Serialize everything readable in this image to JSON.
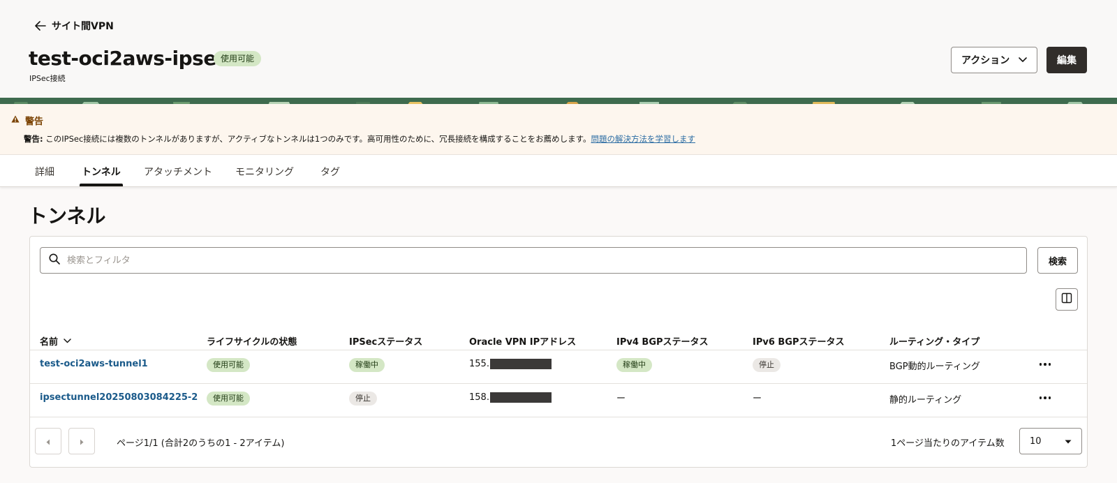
{
  "header": {
    "back_label": "サイト間VPN",
    "title": "test-oci2aws-ipsec",
    "status_badge": "使用可能",
    "subtitle": "IPSec接続",
    "action_label": "アクション",
    "edit_label": "編集"
  },
  "warning": {
    "title": "警告",
    "prefix": "警告:",
    "message": " このIPSec接続には複数のトンネルがありますが、アクティブなトンネルは1つのみです。高可用性のために、冗長接続を構成することをお薦めします。",
    "link": "問題の解決方法を学習します"
  },
  "tabs": [
    {
      "label": "詳細"
    },
    {
      "label": "トンネル"
    },
    {
      "label": "アタッチメント"
    },
    {
      "label": "モニタリング"
    },
    {
      "label": "タグ"
    }
  ],
  "active_tab": "トンネル",
  "section_title": "トンネル",
  "search": {
    "placeholder": "検索とフィルタ",
    "button": "検索"
  },
  "table": {
    "columns": [
      "名前",
      "ライフサイクルの状態",
      "IPSecステータス",
      "Oracle VPN IPアドレス",
      "IPv4 BGPステータス",
      "IPv6 BGPステータス",
      "ルーティング・タイプ"
    ],
    "rows": [
      {
        "name": "test-oci2aws-tunnel1",
        "lifecycle": "使用可能",
        "ipsec_status": "稼働中",
        "ip_prefix": "155.",
        "ipv4_bgp": "稼働中",
        "ipv6_bgp": "停止",
        "routing": "BGP動的ルーティング"
      },
      {
        "name": "ipsectunnel20250803084225-2",
        "lifecycle": "使用可能",
        "ipsec_status": "停止",
        "ip_prefix": "158.",
        "ipv4_bgp": "ー",
        "ipv6_bgp": "ー",
        "routing": "静的ルーティング"
      }
    ]
  },
  "pagination": {
    "summary": "ページ1/1 (合計2のうちの1 - 2アイテム)",
    "per_page_label": "1ページ当たりのアイテム数",
    "per_page_value": "10"
  },
  "colors": {
    "badge_green": "#d4e7c5",
    "badge_gray": "#ebe8e5",
    "link": "#1a5a8a",
    "warning_title": "#7a4100",
    "primary_button": "#312d2a"
  }
}
